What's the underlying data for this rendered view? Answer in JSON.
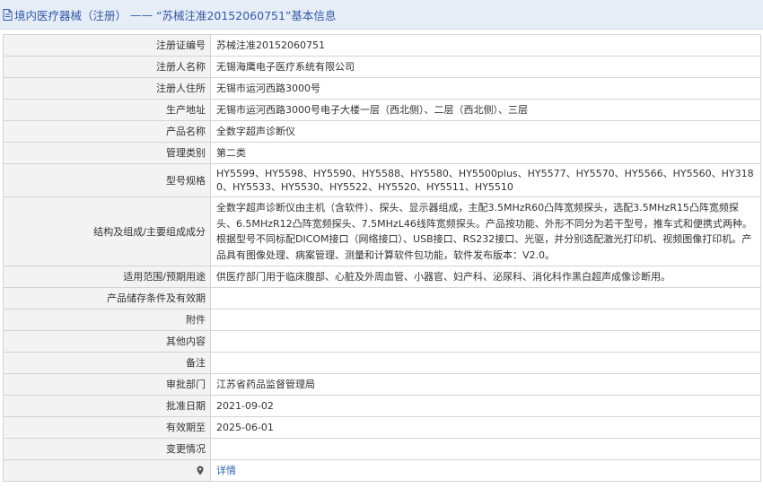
{
  "header": {
    "title_prefix": "境内医疗器械（注册）",
    "separator": " —— ",
    "title_main": "“苏械注准20152060751”基本信息"
  },
  "rows": [
    {
      "label": "注册证编号",
      "value": "苏械注准20152060751"
    },
    {
      "label": "注册人名称",
      "value": "无锡海鹰电子医疗系统有限公司"
    },
    {
      "label": "注册人住所",
      "value": "无锡市运河西路3000号"
    },
    {
      "label": "生产地址",
      "value": "无锡市运河西路3000号电子大楼一层（西北侧）、二层（西北侧）、三层"
    },
    {
      "label": "产品名称",
      "value": "全数字超声诊断仪"
    },
    {
      "label": "管理类别",
      "value": "第二类"
    },
    {
      "label": "型号规格",
      "value": "HY5599、HY5598、HY5590、HY5588、HY5580、HY5500plus、HY5577、HY5570、HY5566、HY5560、HY3180、HY5533、HY5530、HY5522、HY5520、HY5511、HY5510"
    },
    {
      "label": "结构及组成/主要组成成分",
      "value": "全数字超声诊断仪由主机（含软件）、探头、显示器组成，主配3.5MHzR60凸阵宽频探头，选配3.5MHzR15凸阵宽频探头、6.5MHzR12凸阵宽频探头、7.5MHzL46线阵宽频探头。产品按功能、外形不同分为若干型号，推车式和便携式两种。根据型号不同标配DICOM接口（网络接口）、USB接口、RS232接口、光驱，并分别选配激光打印机、视频图像打印机。产品具有图像处理、病案管理、测量和计算软件包功能，软件发布版本：V2.0。"
    },
    {
      "label": "适用范围/预期用途",
      "value": "供医疗部门用于临床腹部、心脏及外周血管、小器官、妇产科、泌尿科、消化科作黑白超声成像诊断用。"
    },
    {
      "label": "产品储存条件及有效期",
      "value": ""
    },
    {
      "label": "附件",
      "value": ""
    },
    {
      "label": "其他内容",
      "value": ""
    },
    {
      "label": "备注",
      "value": ""
    },
    {
      "label": "审批部门",
      "value": "江苏省药品监督管理局"
    },
    {
      "label": "批准日期",
      "value": "2021-09-02"
    },
    {
      "label": "有效期至",
      "value": "2025-06-01"
    },
    {
      "label": "变更情况",
      "value": ""
    },
    {
      "label": "",
      "value": "详情"
    }
  ],
  "colors": {
    "header_bg": "#e7edf6",
    "header_text": "#2f5aa8",
    "label_bg": "#f3f3f3",
    "border": "#d4d4d4",
    "link": "#2f64b4"
  }
}
